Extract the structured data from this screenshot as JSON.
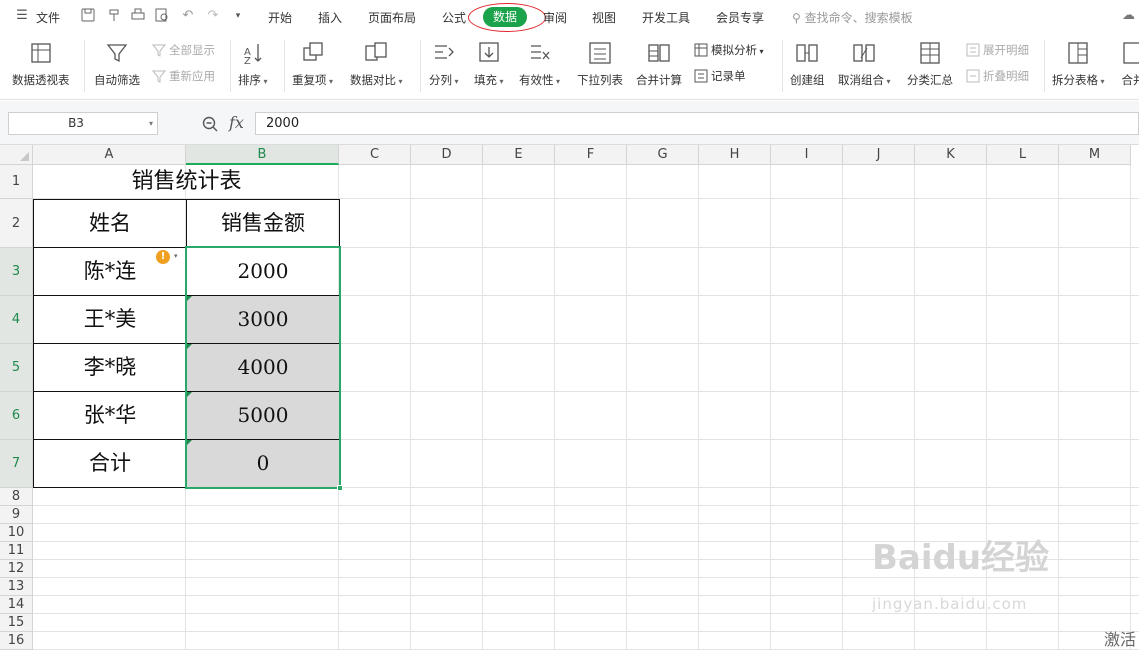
{
  "menubar": {
    "file": "文件",
    "tabs": [
      "开始",
      "插入",
      "页面布局",
      "公式",
      "数据",
      "审阅",
      "视图",
      "开发工具",
      "会员专享"
    ],
    "active_tab": "数据",
    "search_placeholder": "查找命令、搜索模板",
    "accent_color": "#1aa34a",
    "highlight_ring_color": "#e0282e"
  },
  "ribbon": {
    "pivot": "数据透视表",
    "autofilter": "自动筛选",
    "show_all": "全部显示",
    "reapply": "重新应用",
    "sort": "排序",
    "duplicates": "重复项",
    "compare": "数据对比",
    "split": "分列",
    "fill": "填充",
    "validity": "有效性",
    "dropdown_list": "下拉列表",
    "consolidate": "合并计算",
    "whatif": "模拟分析",
    "record_form": "记录单",
    "create_group": "创建组",
    "ungroup": "取消组合",
    "subtotal": "分类汇总",
    "expand_detail": "展开明细",
    "collapse_detail": "折叠明细",
    "split_table": "拆分表格",
    "merge_table": "合并"
  },
  "formula_bar": {
    "name_box": "B3",
    "fx": "fx",
    "value": "2000"
  },
  "sheet": {
    "columns": [
      "A",
      "B",
      "C",
      "D",
      "E",
      "F",
      "G",
      "H",
      "I",
      "J",
      "K",
      "L",
      "M"
    ],
    "rows": [
      "1",
      "2",
      "3",
      "4",
      "5",
      "6",
      "7",
      "8",
      "9",
      "10",
      "11",
      "12",
      "13",
      "14",
      "15",
      "16"
    ],
    "selected_column": "B",
    "title": "销售统计表",
    "header_name": "姓名",
    "header_amount": "销售金额",
    "records": [
      {
        "name": "陈*连",
        "amount": "2000"
      },
      {
        "name": "王*美",
        "amount": "3000"
      },
      {
        "name": "李*晓",
        "amount": "4000"
      },
      {
        "name": "张*华",
        "amount": "5000"
      },
      {
        "name": "合计",
        "amount": "0"
      }
    ],
    "warning_icon": "!",
    "selection_color": "#2aa86a"
  },
  "watermark": {
    "logo": "Baidu经验",
    "url": "jingyan.baidu.com"
  },
  "activate_text": "激活"
}
